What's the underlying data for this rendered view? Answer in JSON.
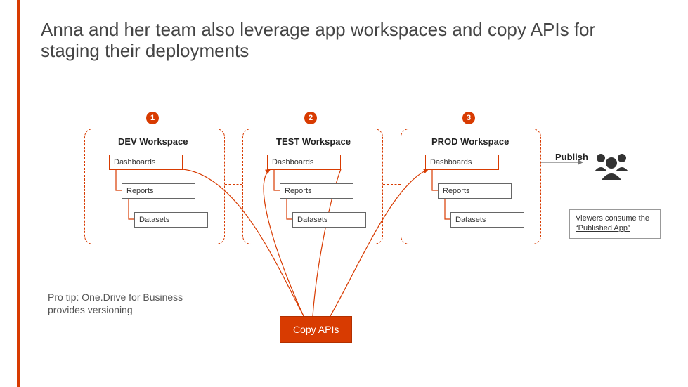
{
  "title": "Anna and her team also leverage app workspaces and copy APIs for staging their deployments",
  "badges": {
    "b1": "1",
    "b2": "2",
    "b3": "3"
  },
  "workspaces": {
    "dev": {
      "label": "DEV Workspace",
      "dashboards": "Dashboards",
      "reports": "Reports",
      "datasets": "Datasets"
    },
    "test": {
      "label": "TEST Workspace",
      "dashboards": "Dashboards",
      "reports": "Reports",
      "datasets": "Datasets"
    },
    "prod": {
      "label": "PROD Workspace",
      "dashboards": "Dashboards",
      "reports": "Reports",
      "datasets": "Datasets"
    }
  },
  "publish_label": "Publish",
  "viewers": {
    "line1": "Viewers consume the",
    "line2": "“Published App”"
  },
  "protip": "Pro tip: One.Drive for Business provides versioning",
  "copy_apis": "Copy APIs",
  "colors": {
    "accent": "#d83b01"
  },
  "chart_data": {
    "type": "diagram",
    "nodes": [
      {
        "id": "dev",
        "label": "DEV Workspace",
        "contains": [
          "Dashboards",
          "Reports",
          "Datasets"
        ],
        "step": 1
      },
      {
        "id": "test",
        "label": "TEST Workspace",
        "contains": [
          "Dashboards",
          "Reports",
          "Datasets"
        ],
        "step": 2
      },
      {
        "id": "prod",
        "label": "PROD Workspace",
        "contains": [
          "Dashboards",
          "Reports",
          "Datasets"
        ],
        "step": 3
      },
      {
        "id": "copy_apis",
        "label": "Copy APIs"
      },
      {
        "id": "viewers",
        "label": "Viewers consume the “Published App”"
      }
    ],
    "edges": [
      {
        "from": "dev",
        "to": "test",
        "via": "copy_apis"
      },
      {
        "from": "test",
        "to": "prod",
        "via": "copy_apis"
      },
      {
        "from": "prod",
        "to": "viewers",
        "label": "Publish"
      }
    ],
    "annotations": [
      "Pro tip: One.Drive for Business provides versioning"
    ]
  }
}
